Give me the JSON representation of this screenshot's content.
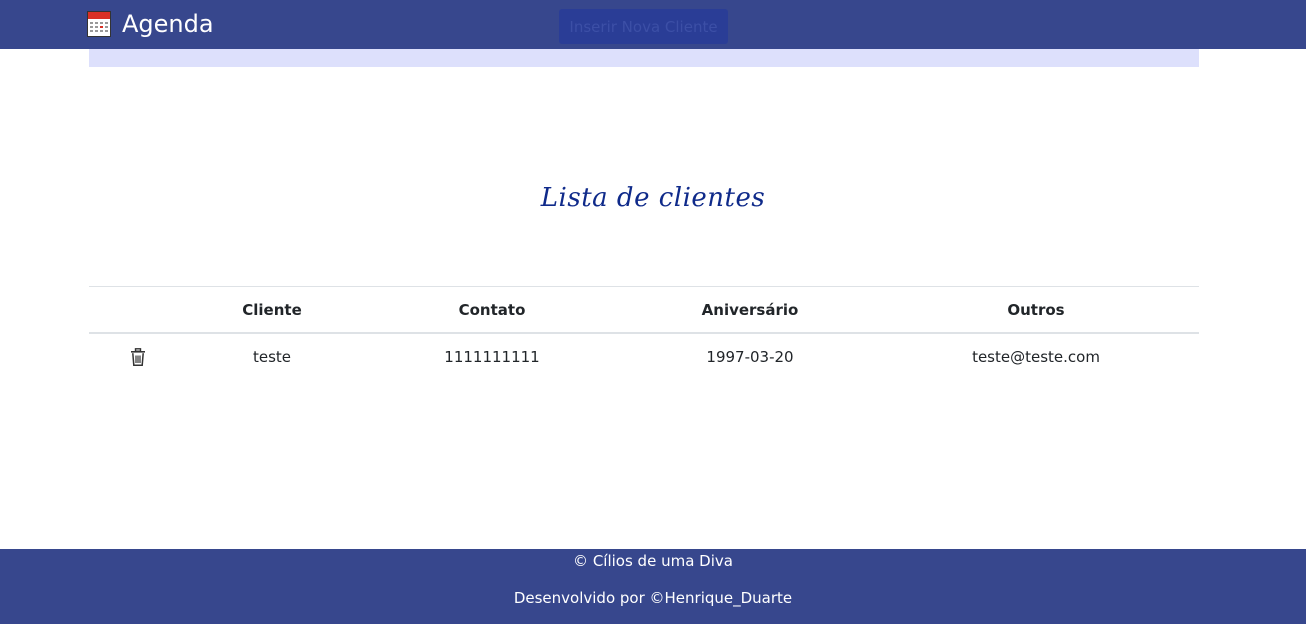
{
  "navbar": {
    "app_name": "Agenda",
    "insert_button_label": "Inserir Nova Cliente",
    "brand_icon": "calendar-icon"
  },
  "main": {
    "title": "Lista de clientes"
  },
  "table": {
    "headers": [
      "",
      "Cliente",
      "Contato",
      "Aniversário",
      "Outros"
    ],
    "rows": [
      {
        "action_icon": "trash-icon",
        "cliente": "teste",
        "contato": "1111111111",
        "aniversario": "1997-03-20",
        "outros": "teste@teste.com"
      }
    ]
  },
  "footer": {
    "copyright": "© Cílios de uma Diva",
    "developer": "Desenvolvido por ©Henrique_Duarte"
  },
  "colors": {
    "navbar_bg": "#37478d",
    "sub_band_bg": "#dde0fc",
    "title_color": "#0f2a8a",
    "footer_bg": "#37478d"
  }
}
